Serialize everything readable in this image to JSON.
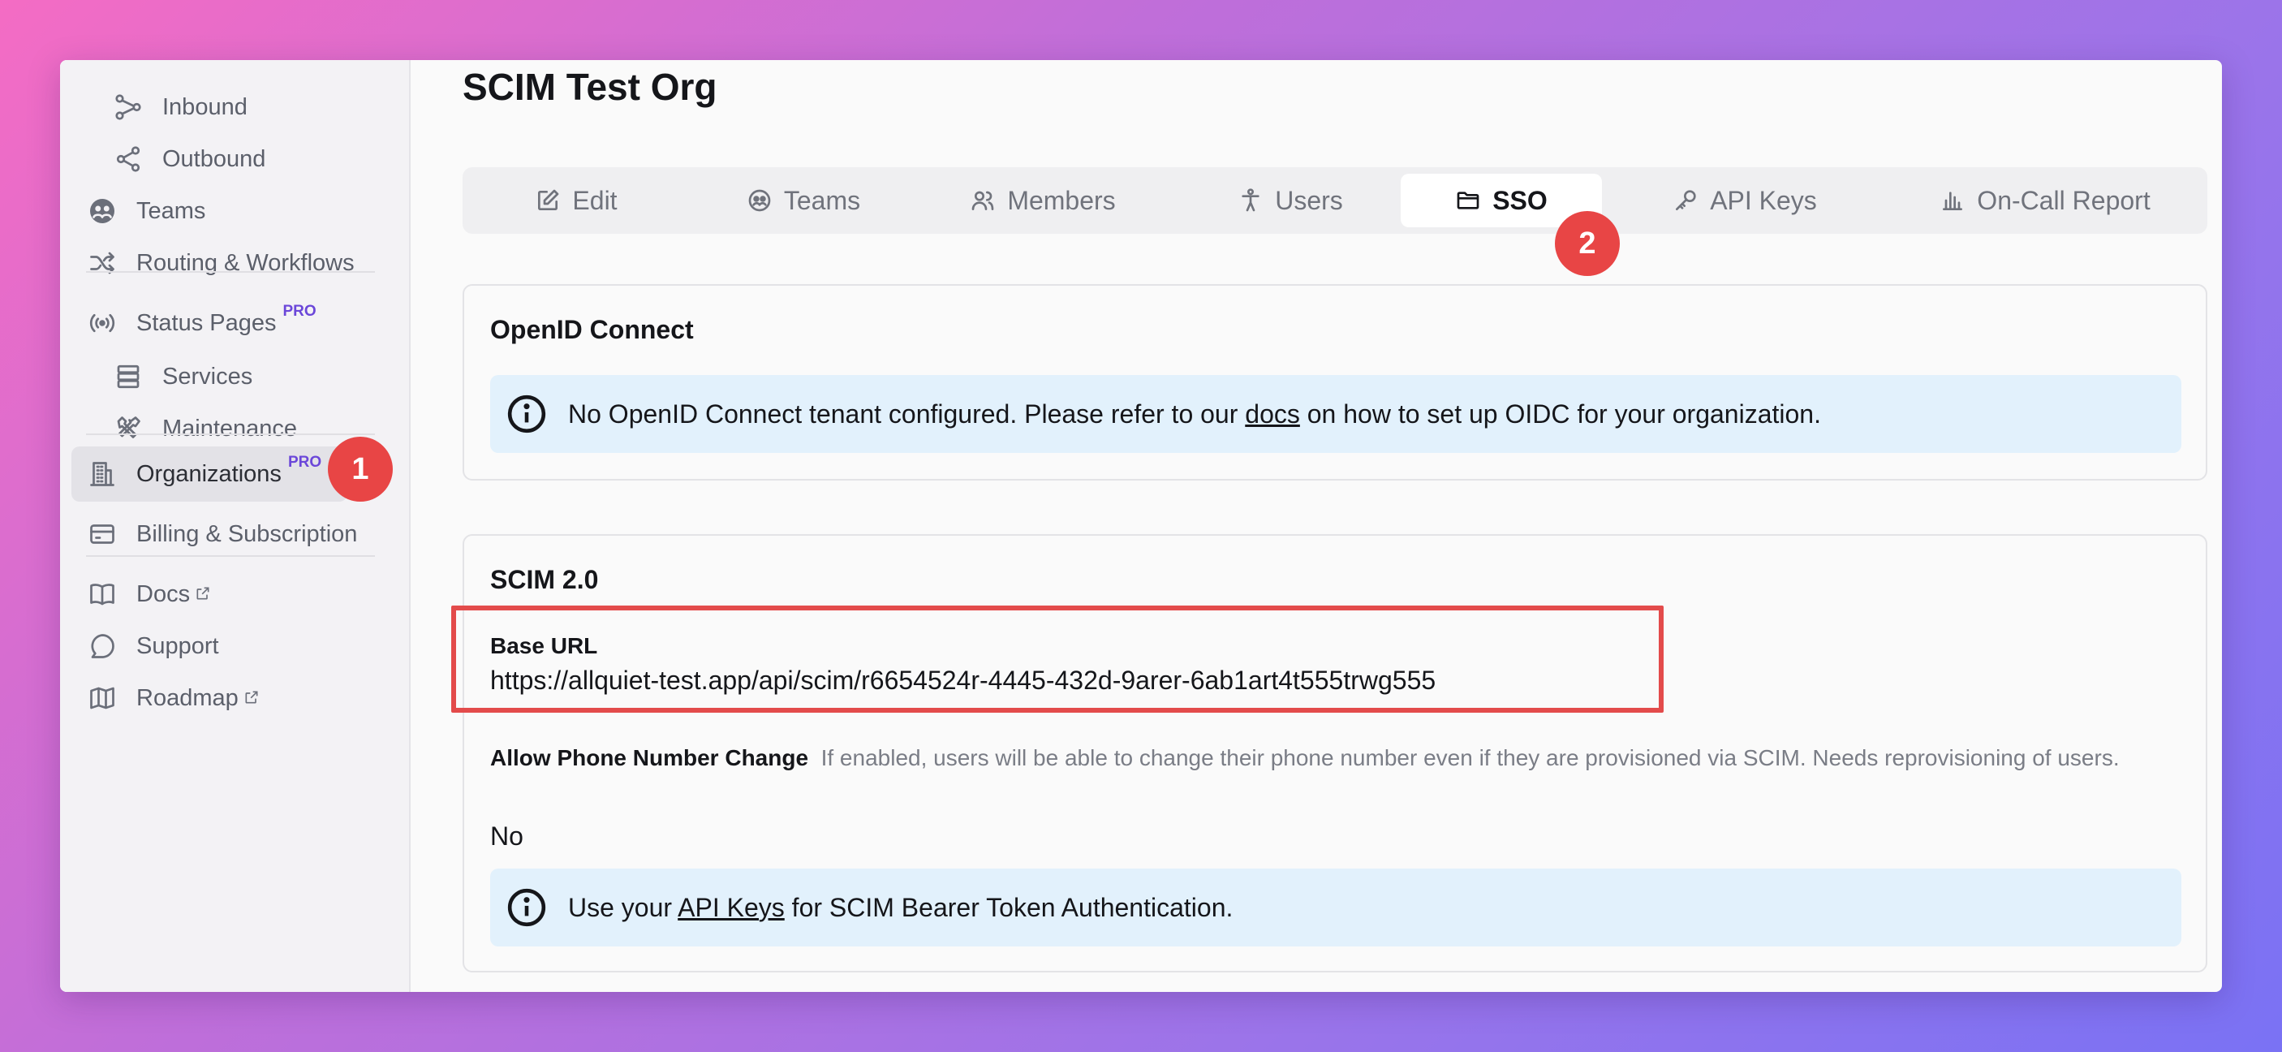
{
  "sidebar": {
    "items": [
      {
        "label": "Inbound",
        "icon": "share-icon"
      },
      {
        "label": "Outbound",
        "icon": "share-icon"
      },
      {
        "label": "Teams",
        "icon": "teams-icon"
      },
      {
        "label": "Routing & Workflows",
        "icon": "shuffle-icon"
      },
      {
        "label": "Status Pages",
        "icon": "broadcast-icon",
        "pro": "PRO"
      },
      {
        "label": "Services",
        "icon": "server-icon"
      },
      {
        "label": "Maintenance",
        "icon": "tools-icon"
      },
      {
        "label": "Organizations",
        "icon": "building-icon",
        "pro": "PRO",
        "active": true
      },
      {
        "label": "Billing & Subscription",
        "icon": "credit-card-icon"
      },
      {
        "label": "Docs",
        "icon": "book-icon",
        "external": true
      },
      {
        "label": "Support",
        "icon": "chat-icon"
      },
      {
        "label": "Roadmap",
        "icon": "map-icon",
        "external": true
      }
    ]
  },
  "annotations": {
    "step1": "1",
    "step2": "2",
    "highlight_color": "#e34b4b",
    "badge_color": "#e84545"
  },
  "page": {
    "title": "SCIM Test Org"
  },
  "tabs": [
    {
      "label": "Edit",
      "icon": "edit-icon"
    },
    {
      "label": "Teams",
      "icon": "teams-icon"
    },
    {
      "label": "Members",
      "icon": "members-icon"
    },
    {
      "label": "Users",
      "icon": "user-icon"
    },
    {
      "label": "SSO",
      "icon": "folder-icon",
      "active": true
    },
    {
      "label": "API Keys",
      "icon": "key-icon"
    },
    {
      "label": "On-Call Report",
      "icon": "bar-chart-icon"
    }
  ],
  "oidc": {
    "title": "OpenID Connect",
    "info_before": "No OpenID Connect tenant configured. Please refer to our ",
    "info_link": "docs",
    "info_after": " on how to set up OIDC for your organization."
  },
  "scim": {
    "title": "SCIM 2.0",
    "base_url_label": "Base URL",
    "base_url": "https://allquiet-test.app/api/scim/r6654524r-4445-432d-9arer-6ab1art4t555trwg555",
    "phone_label": "Allow Phone Number Change",
    "phone_help": "If enabled, users will be able to change their phone number even if they are provisioned via SCIM. Needs reprovisioning of users.",
    "phone_value": "No",
    "info_before": "Use your ",
    "info_link": "API Keys",
    "info_after": " for SCIM Bearer Token Authentication."
  }
}
